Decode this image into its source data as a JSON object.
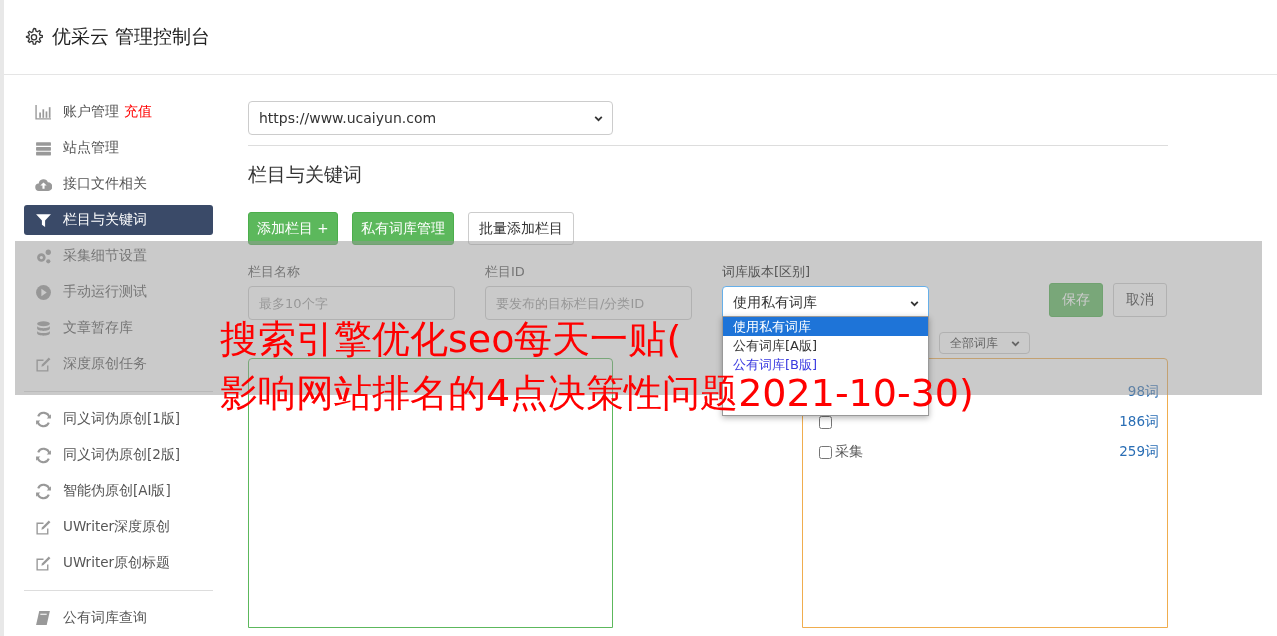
{
  "header": {
    "title": "优采云 管理控制台"
  },
  "sidebar": {
    "groups": [
      [
        {
          "kind": "chart",
          "label": "账户管理",
          "badge": "充值",
          "selected": false
        },
        {
          "kind": "server",
          "label": "站点管理",
          "selected": false
        },
        {
          "kind": "cloud",
          "label": "接口文件相关",
          "selected": false
        },
        {
          "kind": "filter",
          "label": "栏目与关键词",
          "selected": true
        },
        {
          "kind": "cogs",
          "label": "采集细节设置",
          "selected": false
        },
        {
          "kind": "play",
          "label": "手动运行测试",
          "selected": false
        },
        {
          "kind": "database",
          "label": "文章暂存库",
          "selected": false
        },
        {
          "kind": "edit",
          "label": "深度原创任务",
          "selected": false
        }
      ],
      [
        {
          "kind": "refresh",
          "label": "同义词伪原创[1版]",
          "selected": false
        },
        {
          "kind": "refresh",
          "label": "同义词伪原创[2版]",
          "selected": false
        },
        {
          "kind": "refresh",
          "label": "智能伪原创[AI版]",
          "selected": false
        },
        {
          "kind": "edit",
          "label": "UWriter深度原创",
          "selected": false
        },
        {
          "kind": "edit",
          "label": "UWriter原创标题",
          "selected": false
        }
      ],
      [
        {
          "kind": "book",
          "label": "公有词库查询",
          "selected": false
        }
      ]
    ]
  },
  "site_select": {
    "value": "https://www.ucaiyun.com"
  },
  "section_title": "栏目与关键词",
  "buttons": [
    {
      "kind": "success",
      "label": "添加栏目 +"
    },
    {
      "kind": "success",
      "label": "私有词库管理"
    },
    {
      "kind": "default",
      "label": "批量添加栏目"
    }
  ],
  "form": {
    "fields": [
      {
        "kind": "input",
        "label": "栏目名称",
        "placeholder": "最多10个字"
      },
      {
        "kind": "input",
        "label": "栏目ID",
        "placeholder": "要发布的目标栏目/分类ID"
      },
      {
        "kind": "select",
        "label": "词库版本[区别]",
        "value": "使用私有词库"
      }
    ],
    "save": "保存",
    "cancel": "取消"
  },
  "version_menu": [
    {
      "label": "使用私有词库",
      "selected": true
    },
    {
      "label": "公有词库[A版]",
      "selected": false,
      "color": "#333333"
    },
    {
      "label": "公有词库[B版]",
      "selected": false,
      "color": "#3a3ae0"
    }
  ],
  "library_filter": {
    "value": "全部词库"
  },
  "libraries": [
    {
      "count": "98词"
    },
    {
      "count": "186词",
      "checked": false
    },
    {
      "label": "采集",
      "count": "259词",
      "checked": false
    }
  ],
  "headline": [
    "搜索引擎优化seo每天一贴(",
    "影响网站排名的4点决策性问题2021-10-30)"
  ]
}
